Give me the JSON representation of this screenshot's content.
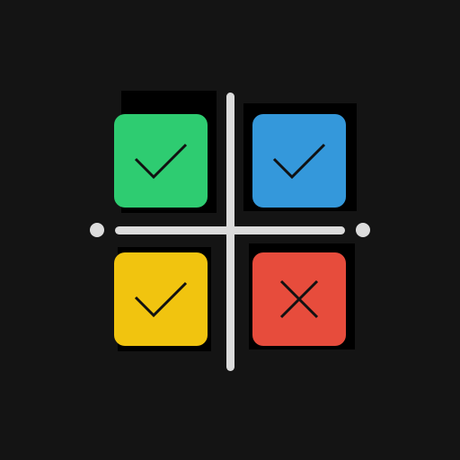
{
  "icon": {
    "background_color": "#141414",
    "line_color": "#dcdcdc",
    "tiles": [
      {
        "position": "top-left",
        "color": "#2ecc71",
        "mark": "check-icon"
      },
      {
        "position": "top-right",
        "color": "#3498db",
        "mark": "check-icon"
      },
      {
        "position": "bottom-left",
        "color": "#f1c40f",
        "mark": "check-icon"
      },
      {
        "position": "bottom-right",
        "color": "#e74c3c",
        "mark": "cross-icon"
      }
    ],
    "mark_color": "#111111"
  }
}
